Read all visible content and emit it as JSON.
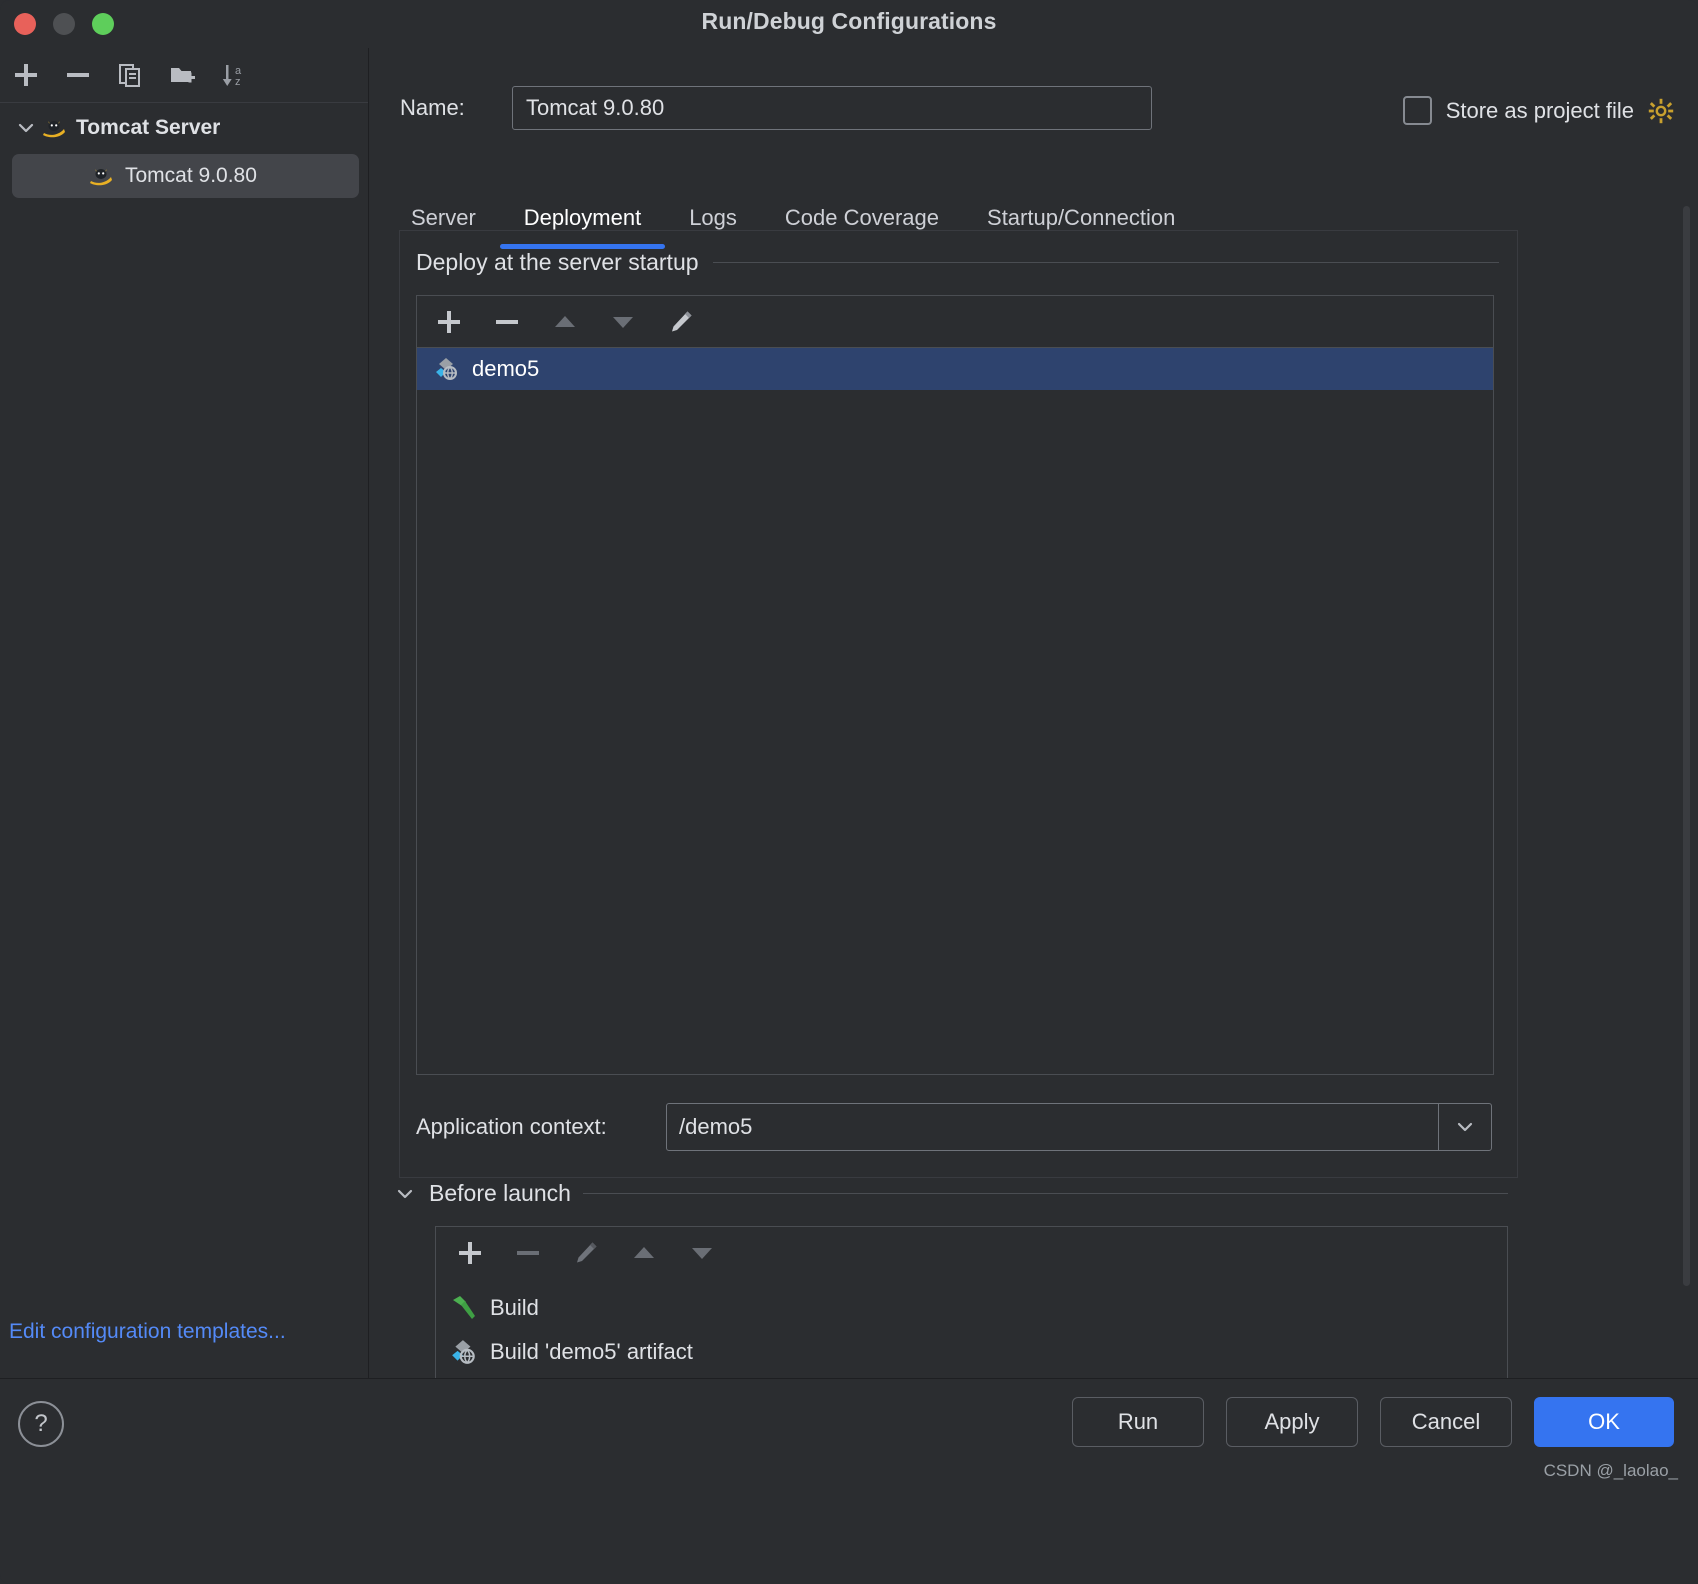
{
  "window": {
    "title": "Run/Debug Configurations",
    "traffic_lights": [
      "close-red",
      "minimize-gray",
      "zoom-green"
    ]
  },
  "left_panel": {
    "toolbar": [
      {
        "name": "add",
        "glyph": "+"
      },
      {
        "name": "remove",
        "glyph": "−"
      },
      {
        "name": "copy",
        "glyph": "copy"
      },
      {
        "name": "new-folder",
        "glyph": "folder-plus"
      },
      {
        "name": "sort-alphabetically",
        "glyph": "sort-az"
      }
    ],
    "tree": {
      "group_label": "Tomcat Server",
      "children": [
        {
          "label": "Tomcat 9.0.80",
          "selected": true
        }
      ]
    },
    "edit_templates_link": "Edit configuration templates..."
  },
  "form": {
    "name_label": "Name:",
    "name_value": "Tomcat 9.0.80",
    "name_placeholder": "Name",
    "store_as_project_file_label": "Store as project file",
    "store_as_project_file_checked": false,
    "gear_icon": "gear-icon"
  },
  "tabs": [
    {
      "label": "Server",
      "active": false
    },
    {
      "label": "Deployment",
      "active": true
    },
    {
      "label": "Logs",
      "active": false
    },
    {
      "label": "Code Coverage",
      "active": false
    },
    {
      "label": "Startup/Connection",
      "active": false
    }
  ],
  "deployment": {
    "section_title": "Deploy at the server startup",
    "toolbar": [
      {
        "name": "add-artifact",
        "glyph": "+",
        "enabled": true
      },
      {
        "name": "remove-artifact",
        "glyph": "−",
        "enabled": true
      },
      {
        "name": "move-up",
        "glyph": "up",
        "enabled": false
      },
      {
        "name": "move-down",
        "glyph": "down",
        "enabled": false
      },
      {
        "name": "edit-artifact",
        "glyph": "pencil",
        "enabled": true
      }
    ],
    "items": [
      {
        "label": "demo5",
        "icon": "artifact-icon",
        "selected": true
      }
    ],
    "application_context_label": "Application context:",
    "application_context_value": "/demo5"
  },
  "before_launch": {
    "title": "Before launch",
    "expanded": true,
    "toolbar": [
      {
        "name": "add-task",
        "glyph": "+",
        "enabled": true
      },
      {
        "name": "remove-task",
        "glyph": "−",
        "enabled": false
      },
      {
        "name": "edit-task",
        "glyph": "pencil",
        "enabled": false
      },
      {
        "name": "move-task-up",
        "glyph": "up",
        "enabled": false
      },
      {
        "name": "move-task-down",
        "glyph": "down",
        "enabled": false
      }
    ],
    "tasks": [
      {
        "label": "Build",
        "icon": "hammer-icon"
      },
      {
        "label": "Build 'demo5' artifact",
        "icon": "artifact-icon"
      }
    ]
  },
  "footer": {
    "help_glyph": "?",
    "buttons": [
      {
        "label": "Run",
        "primary": false
      },
      {
        "label": "Apply",
        "primary": false
      },
      {
        "label": "Cancel",
        "primary": false
      },
      {
        "label": "OK",
        "primary": true
      }
    ],
    "watermark": "CSDN @_laolao_"
  },
  "colors": {
    "background": "#2b2d30",
    "accent": "#3574f0",
    "selection": "#2e436e",
    "link": "#548af7",
    "text": "#dfe1e5"
  }
}
